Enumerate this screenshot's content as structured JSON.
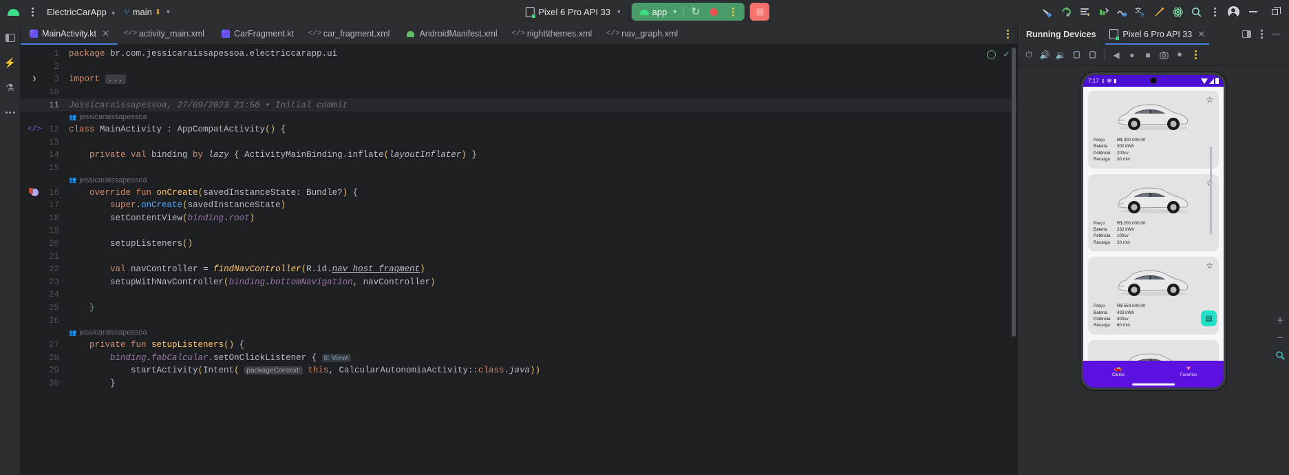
{
  "topbar": {
    "logo_icon": "android-logo-icon",
    "main_menu_icon": "hamburger-kebab-icon",
    "project_name": "ElectricCarApp",
    "project_chevron": "▾",
    "branch_icon": "git-branch-icon",
    "branch_name": "main",
    "branch_download_icon": "download-arrow-icon",
    "branch_chevron": "▾",
    "device": {
      "icon": "device-phone-icon",
      "label": "Pixel 6 Pro API 33",
      "chevron": "▾"
    },
    "run_config": {
      "icon": "android-logo-icon",
      "label": "app",
      "chevron": "▾",
      "rerun_icon": "rerun-circular-arrow-icon",
      "stop_icon": "stop-record-dot-icon",
      "more_icon": "kebab-menu-icon"
    },
    "red_button_icon": "stop-square-icon",
    "right_icons": [
      {
        "name": "build-hammer-icon",
        "glyph": "build"
      },
      {
        "name": "sync-gradle-icon",
        "glyph": "sync"
      },
      {
        "name": "logcat-icon",
        "glyph": "logcat"
      },
      {
        "name": "profiler-icon",
        "glyph": "profiler"
      },
      {
        "name": "device-explorer-icon",
        "glyph": "explorer"
      },
      {
        "name": "translations-editor-icon",
        "glyph": "translate"
      },
      {
        "name": "tools-icon",
        "glyph": "tools"
      },
      {
        "name": "atom-plugin-icon",
        "glyph": "atom"
      },
      {
        "name": "search-everywhere-icon",
        "glyph": "search"
      },
      {
        "name": "more-options-icon",
        "glyph": "kebab"
      },
      {
        "name": "account-avatar-icon",
        "glyph": "avatar"
      }
    ],
    "window_controls": {
      "minimize": "minimize-icon",
      "maximize": "maximize-icon"
    }
  },
  "left_rail": [
    {
      "name": "sidebar-item-project",
      "icon": "project-panel-icon"
    },
    {
      "name": "sidebar-item-bookmarks",
      "icon": "bolt-icon"
    },
    {
      "name": "sidebar-item-structure",
      "icon": "flask-icon"
    },
    {
      "name": "sidebar-item-more",
      "icon": "more-dots-icon"
    }
  ],
  "tabs": [
    {
      "label": "MainActivity.kt",
      "icon": "kotlin-file-icon",
      "active": true,
      "closable": true
    },
    {
      "label": "activity_main.xml",
      "icon": "xml-file-icon",
      "active": false,
      "closable": false
    },
    {
      "label": "CarFragment.kt",
      "icon": "kotlin-file-icon",
      "active": false,
      "closable": false
    },
    {
      "label": "car_fragment.xml",
      "icon": "xml-file-icon",
      "active": false,
      "closable": false
    },
    {
      "label": "AndroidManifest.xml",
      "icon": "manifest-file-icon",
      "active": false,
      "closable": false
    },
    {
      "label": "night\\themes.xml",
      "icon": "xml-file-icon",
      "active": false,
      "closable": false
    },
    {
      "label": "nav_graph.xml",
      "icon": "xml-file-icon",
      "active": false,
      "closable": false
    }
  ],
  "tabbar_more_icon": "kebab-menu-icon",
  "editor": {
    "inspection_ok_icon": "inspections-ok-icon",
    "check_icon": "analysis-check-icon",
    "blame_author": "jessicaraissapessoa",
    "commit_annotation": "Jessicaraissapessoa, 27/09/2023 21:56 • Initial commit",
    "lines": [
      {
        "num": "1",
        "gutter": "",
        "indent": 0,
        "text": "package br.com.jessicaraissapessoa.electriccarapp.ui"
      },
      {
        "num": "2",
        "gutter": "",
        "indent": 0,
        "text": ""
      },
      {
        "num": "3",
        "gutter": "fold",
        "indent": 0,
        "text": "import ..."
      },
      {
        "num": "10",
        "gutter": "",
        "indent": 0,
        "text": ""
      },
      {
        "num": "11",
        "gutter": "",
        "indent": 0,
        "text": ""
      },
      {
        "num": "12",
        "gutter": "code",
        "indent": 0,
        "text": "class MainActivity : AppCompatActivity() {"
      },
      {
        "num": "13",
        "gutter": "",
        "indent": 0,
        "text": ""
      },
      {
        "num": "14",
        "gutter": "",
        "indent": 1,
        "text": "private val binding by lazy { ActivityMainBinding.inflate(layoutInflater) }"
      },
      {
        "num": "15",
        "gutter": "",
        "indent": 0,
        "text": ""
      },
      {
        "num": "16",
        "gutter": "run",
        "indent": 1,
        "text": "override fun onCreate(savedInstanceState: Bundle?) {"
      },
      {
        "num": "17",
        "gutter": "",
        "indent": 2,
        "text": "super.onCreate(savedInstanceState)"
      },
      {
        "num": "18",
        "gutter": "",
        "indent": 2,
        "text": "setContentView(binding.root)"
      },
      {
        "num": "19",
        "gutter": "",
        "indent": 0,
        "text": ""
      },
      {
        "num": "20",
        "gutter": "",
        "indent": 2,
        "text": "setupListeners()"
      },
      {
        "num": "21",
        "gutter": "",
        "indent": 0,
        "text": ""
      },
      {
        "num": "22",
        "gutter": "",
        "indent": 2,
        "text": "val navController = findNavController(R.id.nav_host_fragment)"
      },
      {
        "num": "23",
        "gutter": "",
        "indent": 2,
        "text": "setupWithNavController(binding.bottomNavigation, navController)"
      },
      {
        "num": "24",
        "gutter": "",
        "indent": 0,
        "text": ""
      },
      {
        "num": "25",
        "gutter": "",
        "indent": 1,
        "text": "}"
      },
      {
        "num": "26",
        "gutter": "",
        "indent": 0,
        "text": ""
      },
      {
        "num": "27",
        "gutter": "",
        "indent": 1,
        "text": "private fun setupListeners() {"
      },
      {
        "num": "28",
        "gutter": "",
        "indent": 2,
        "text": "binding.fabCalcular.setOnClickListener { it: View! "
      },
      {
        "num": "29",
        "gutter": "",
        "indent": 3,
        "text": "startActivity(Intent( packageContext: this, CalcularAutonomiaActivity::class.java))"
      },
      {
        "num": "30",
        "gutter": "",
        "indent": 2,
        "text": "}"
      }
    ],
    "inlay_hints": {
      "it_view": "it: View!",
      "package_context": "packageContext:"
    }
  },
  "running_devices": {
    "panel_title": "Running Devices",
    "tab": {
      "label": "Pixel 6 Pro API 33",
      "icon": "device-phone-icon",
      "close_icon": "close-icon"
    },
    "header_icons": [
      {
        "name": "split-panel-icon"
      },
      {
        "name": "panel-options-kebab-icon"
      },
      {
        "name": "hide-panel-icon"
      }
    ],
    "toolbar_icons": [
      {
        "name": "power-button-icon",
        "glyph": "⏻"
      },
      {
        "name": "volume-up-icon",
        "glyph": "🔊"
      },
      {
        "name": "volume-down-icon",
        "glyph": "🔉"
      },
      {
        "name": "rotate-left-icon",
        "glyph": "↺"
      },
      {
        "name": "rotate-right-icon",
        "glyph": "↻"
      },
      {
        "name": "back-button-icon",
        "glyph": "◀"
      },
      {
        "name": "home-button-icon",
        "glyph": "●"
      },
      {
        "name": "overview-button-icon",
        "glyph": "■"
      },
      {
        "name": "screenshot-icon",
        "glyph": "📷"
      },
      {
        "name": "screen-record-icon",
        "glyph": "⏺"
      },
      {
        "name": "device-more-icon",
        "glyph": "⋮"
      }
    ],
    "side_icons": [
      {
        "name": "zoom-in-icon",
        "glyph": "+"
      },
      {
        "name": "zoom-out-icon",
        "glyph": "−"
      },
      {
        "name": "zoom-actual-icon",
        "glyph": "⌕"
      }
    ],
    "device_screen": {
      "status_bar": {
        "time": "7:17",
        "icons": [
          "vpn-key-icon",
          "bluetooth-icon",
          "notification-icon"
        ],
        "right_icons": [
          "wifi-icon",
          "signal-icon",
          "battery-icon"
        ]
      },
      "cards": [
        {
          "image": "electric-car-image",
          "favorite_icon": "star-outline-icon",
          "specs": [
            {
              "label": "Preço",
              "value": "R$ 300.000,00"
            },
            {
              "label": "Bateria",
              "value": "300 kWh"
            },
            {
              "label": "Potência",
              "value": "200cv"
            },
            {
              "label": "Recarga",
              "value": "30 min"
            }
          ]
        },
        {
          "image": "electric-car-image",
          "favorite_icon": "star-outline-icon",
          "specs": [
            {
              "label": "Preço",
              "value": "R$ 200.000,00"
            },
            {
              "label": "Bateria",
              "value": "232 kWh"
            },
            {
              "label": "Potência",
              "value": "100cv"
            },
            {
              "label": "Recarga",
              "value": "20 min"
            }
          ]
        },
        {
          "image": "electric-car-image",
          "favorite_icon": "star-outline-icon",
          "specs": [
            {
              "label": "Preço",
              "value": "R$ 554.000,00"
            },
            {
              "label": "Bateria",
              "value": "433 kWh"
            },
            {
              "label": "Potência",
              "value": "400cv"
            },
            {
              "label": "Recarga",
              "value": "60 min"
            }
          ]
        },
        {
          "image": "electric-car-image",
          "favorite_icon": "star-outline-icon",
          "specs": []
        }
      ],
      "fab": {
        "icon": "calculator-icon",
        "label": ""
      },
      "bottom_nav": [
        {
          "label": "Carros",
          "icon": "car-icon",
          "active": true
        },
        {
          "label": "Favoritos",
          "icon": "heart-icon",
          "active": false
        }
      ]
    }
  },
  "colors": {
    "accent_blue": "#4682d6",
    "run_green": "#4a9b6a",
    "stop_red": "#f0524d",
    "app_purple": "#5b12e0",
    "status_purple": "#4b0fd4",
    "fab_teal": "#20e0c8",
    "editor_bg": "#1e1f22",
    "chrome_bg": "#2b2d30"
  }
}
